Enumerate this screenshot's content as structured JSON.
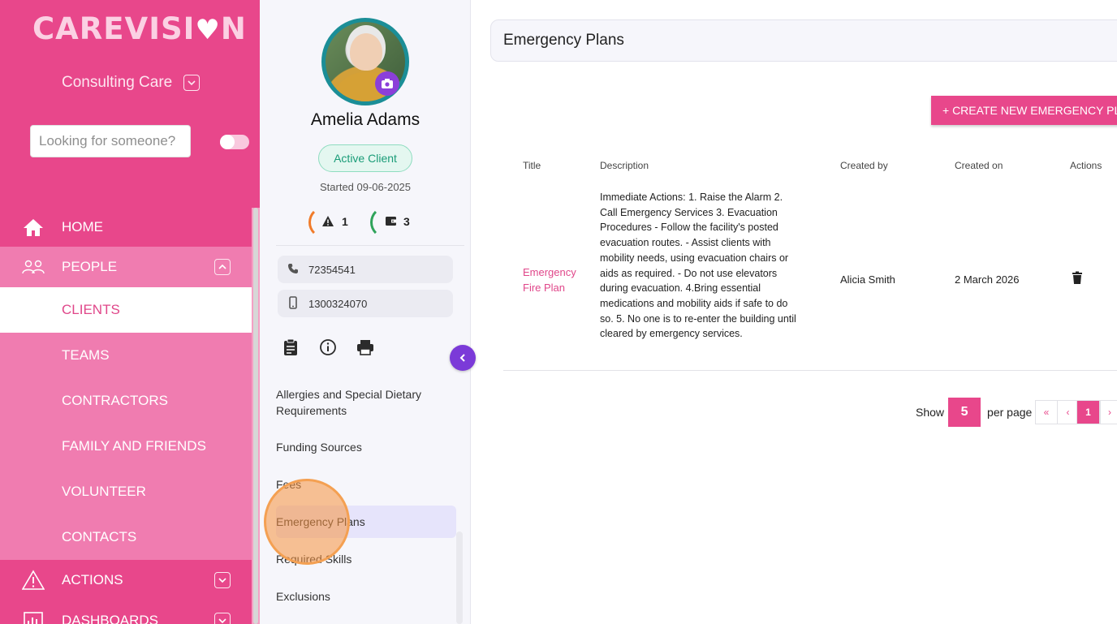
{
  "sidebar": {
    "logo_text": "CAREVISI",
    "logo_heart": "♥",
    "logo_tail": "N",
    "org_name": "Consulting Care",
    "search_placeholder": "Looking for someone?",
    "nav": {
      "home": "HOME",
      "people": "PEOPLE",
      "clients": "CLIENTS",
      "teams": "TEAMS",
      "contractors": "CONTRACTORS",
      "family": "FAMILY AND FRIENDS",
      "volunteer": "VOLUNTEER",
      "contacts": "CONTACTS",
      "actions": "ACTIONS",
      "dashboards": "DASHBOARDS"
    }
  },
  "client": {
    "name": "Amelia Adams",
    "status": "Active Client",
    "started": "Started 09-06-2025",
    "alerts_count": "1",
    "funding_count": "3",
    "phone": "72354541",
    "mobile": "1300324070",
    "menu": {
      "allergies": "Allergies and Special Dietary Requirements",
      "funding": "Funding Sources",
      "fees": "Fees",
      "emergency": "Emergency Plans",
      "skills": "Required Skills",
      "exclusions": "Exclusions"
    }
  },
  "main": {
    "title": "Emergency Plans",
    "create_button": "+ CREATE NEW EMERGENCY PLAN",
    "columns": {
      "title": "Title",
      "description": "Description",
      "created_by": "Created by",
      "created_on": "Created on",
      "actions": "Actions"
    },
    "rows": [
      {
        "title": "Emergency Fire Plan",
        "description": "Immediate Actions: 1. Raise the Alarm 2. Call Emergency Services 3. Evacuation Procedures - Follow the facility's posted evacuation routes. - Assist clients with mobility needs, using evacuation chairs or aids as required. - Do not use elevators during evacuation. 4.Bring essential medications and mobility aids if safe to do so. 5. No one is to re-enter the building until cleared by emergency services.",
        "created_by": "Alicia Smith",
        "created_on": "2 March 2026"
      }
    ],
    "pagination": {
      "show_label": "Show",
      "per_page_value": "5",
      "per_page_label": "per page",
      "first": "«",
      "prev": "‹",
      "current": "1",
      "next": "›"
    }
  },
  "colors": {
    "brand_pink": "#e8478b",
    "accent_purple": "#7b3ad8",
    "status_green": "#1a9c78"
  }
}
